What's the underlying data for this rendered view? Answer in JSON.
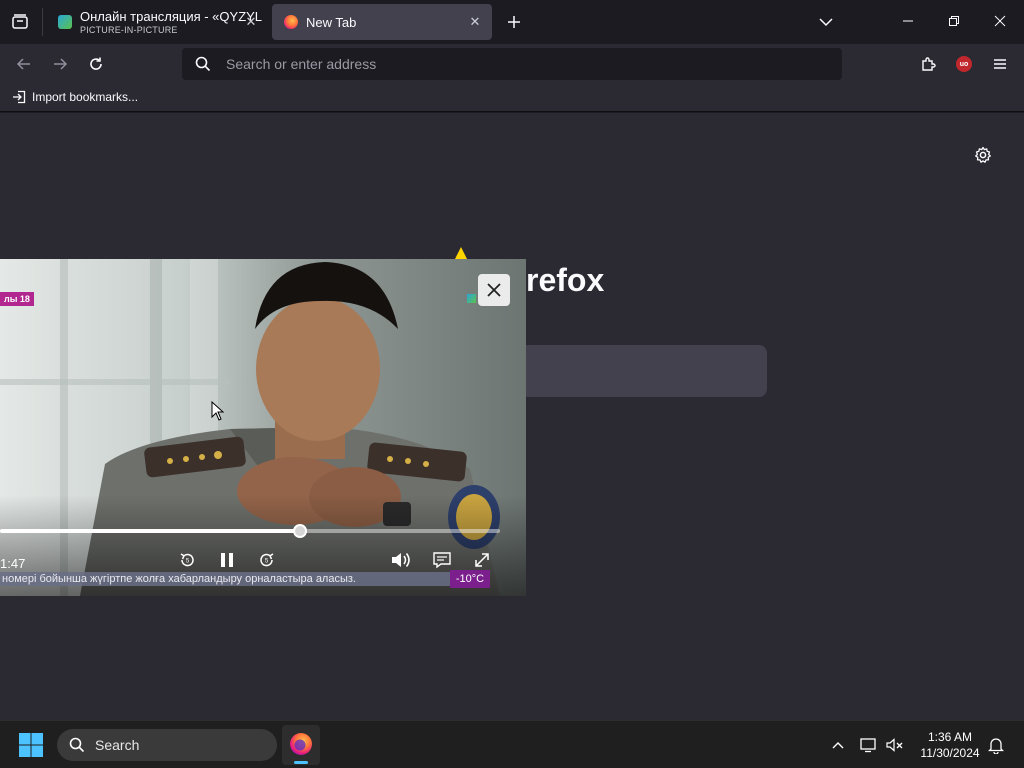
{
  "tabs": [
    {
      "title": "Онлайн трансляция - «QYZYL",
      "subtitle": "PICTURE-IN-PICTURE",
      "active": false
    },
    {
      "title": "New Tab",
      "subtitle": "",
      "active": true
    }
  ],
  "toolbar": {
    "address_placeholder": "Search or enter address",
    "extension_badge": "uo"
  },
  "bookmarks": {
    "import_label": "Import bookmarks..."
  },
  "newtab": {
    "brand_text": "refox"
  },
  "pip": {
    "time_elapsed": "1:47",
    "channel_badge": "лы 18",
    "ticker_text": "номері бойынша жүгіртпе жолға хабарландыру орналастыра аласыз.",
    "temperature": "-10°C",
    "progress": 0.6
  },
  "taskbar": {
    "search_placeholder": "Search",
    "time": "1:36 AM",
    "date": "11/30/2024"
  },
  "colors": {
    "accent": "#00ddff",
    "toolbar_bg": "#2b2a33",
    "tabstrip_bg": "#1c1b22",
    "ublock_red": "#c0282d",
    "ticker_bg": "#7a1f8c"
  }
}
